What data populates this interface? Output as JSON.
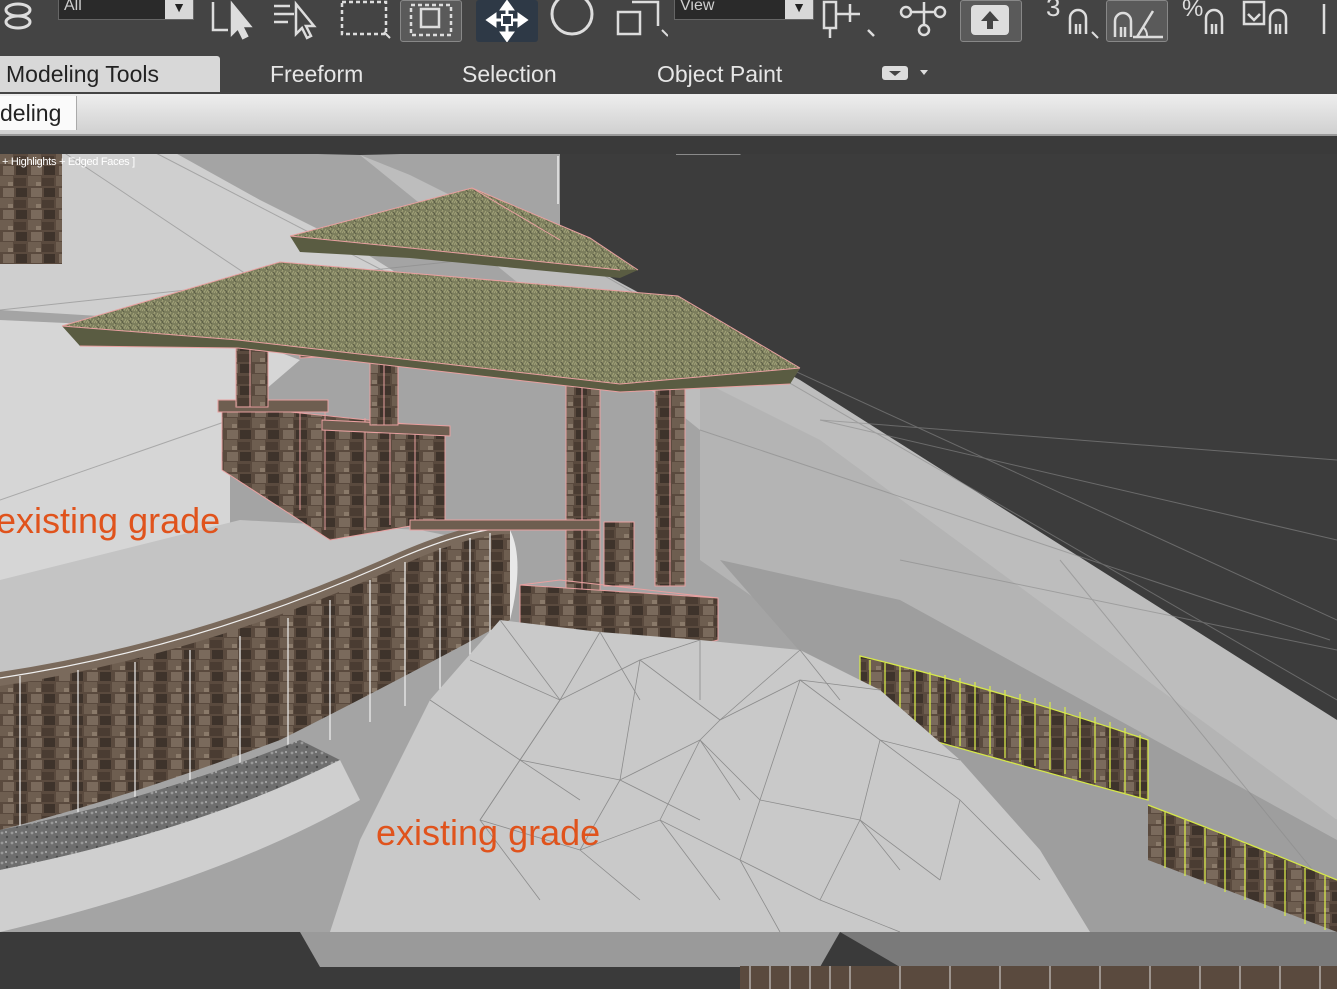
{
  "toolbar": {
    "selection_filter": {
      "value": "All"
    },
    "reference_coord": {
      "value": "View"
    },
    "icons": [
      "link-icon",
      "select-object-icon",
      "select-by-name-icon",
      "rectangular-selection-icon",
      "window-crossing-icon",
      "select-and-move-icon",
      "select-and-rotate-icon",
      "select-and-scale-icon",
      "use-pivot-center-icon",
      "select-and-manipulate-icon",
      "keyboard-shortcut-override-icon",
      "snaps-toggle-icon",
      "angle-snap-icon",
      "percent-snap-icon",
      "spinner-snap-icon"
    ]
  },
  "ribbon": {
    "tabs": [
      {
        "label": "Modeling Tools",
        "active": true
      },
      {
        "label": "Freeform",
        "active": false
      },
      {
        "label": "Selection",
        "active": false
      },
      {
        "label": "Object Paint",
        "active": false
      }
    ],
    "panel_tab": "deling"
  },
  "viewport": {
    "label": "+ Highlights + Edged Faces ]",
    "annotations": [
      "existing grade",
      "existing grade"
    ]
  },
  "colors": {
    "annotation": "#e0531c",
    "selection_highlight": "#e8a0a0",
    "selected_wall": "#d6e84a",
    "terrain": "#c8c8c8",
    "background": "#444444"
  }
}
